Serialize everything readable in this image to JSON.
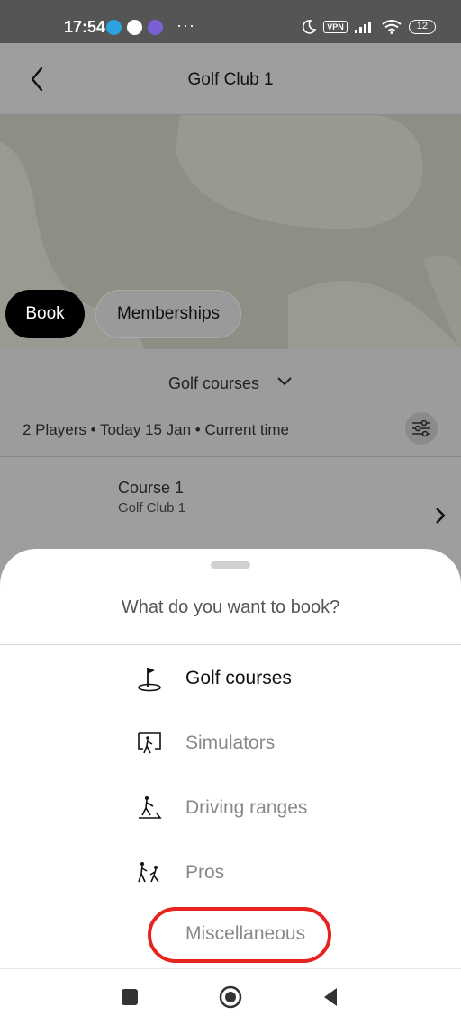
{
  "status_bar": {
    "time": "17:54",
    "more": "···",
    "vpn": "VPN",
    "battery": "12"
  },
  "header": {
    "title": "Golf Club 1"
  },
  "tabs": {
    "book": "Book",
    "memberships": "Memberships"
  },
  "filter": {
    "category": "Golf courses",
    "summary": "2 Players • Today 15 Jan • Current time"
  },
  "course": {
    "name": "Course 1",
    "club": "Golf Club 1"
  },
  "sheet": {
    "title": "What do you want to book?",
    "options": [
      {
        "label": "Golf courses",
        "icon": "golf-flag-icon",
        "selected": true
      },
      {
        "label": "Simulators",
        "icon": "simulator-icon",
        "selected": false
      },
      {
        "label": "Driving ranges",
        "icon": "driving-range-icon",
        "selected": false
      },
      {
        "label": "Pros",
        "icon": "golf-pro-icon",
        "selected": false
      },
      {
        "label": "Miscellaneous",
        "icon": "",
        "selected": false
      }
    ]
  },
  "colors": {
    "accent": "#000000",
    "highlight": "#e8231d"
  }
}
